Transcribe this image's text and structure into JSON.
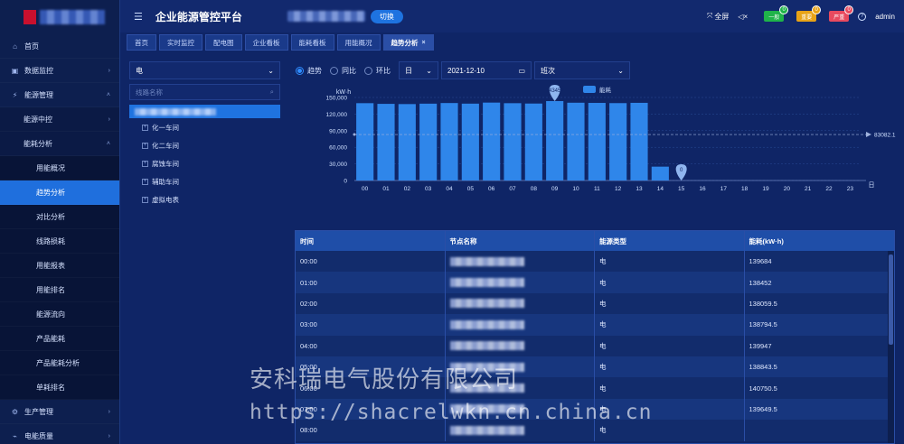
{
  "app": {
    "title": "企业能源管控平台",
    "switch_label": "切换",
    "fullscreen_label": "全屏",
    "user": "admin"
  },
  "alarms": [
    {
      "label": "一般",
      "count": "0",
      "color": "#1fb34a"
    },
    {
      "label": "重要",
      "count": "0",
      "color": "#e8a317"
    },
    {
      "label": "严重",
      "count": "0",
      "color": "#e84a5f"
    }
  ],
  "sidebar": {
    "items": [
      {
        "label": "首页",
        "icon": "home-icon",
        "level": 0,
        "arrow": ""
      },
      {
        "label": "数据监控",
        "icon": "monitor-icon",
        "level": 0,
        "arrow": "›"
      },
      {
        "label": "能源管理",
        "icon": "energy-icon",
        "level": 0,
        "arrow": "˄"
      },
      {
        "label": "能源中控",
        "level": 1,
        "arrow": "›"
      },
      {
        "label": "能耗分析",
        "level": 1,
        "arrow": "˄"
      },
      {
        "label": "用能概况",
        "level": 2,
        "arrow": ""
      },
      {
        "label": "趋势分析",
        "level": 2,
        "arrow": "",
        "active": true
      },
      {
        "label": "对比分析",
        "level": 2,
        "arrow": ""
      },
      {
        "label": "线路损耗",
        "level": 2,
        "arrow": ""
      },
      {
        "label": "用能报表",
        "level": 2,
        "arrow": ""
      },
      {
        "label": "用能排名",
        "level": 2,
        "arrow": ""
      },
      {
        "label": "能源流向",
        "level": 2,
        "arrow": ""
      },
      {
        "label": "产品能耗",
        "level": 2,
        "arrow": ""
      },
      {
        "label": "产品能耗分析",
        "level": 2,
        "arrow": ""
      },
      {
        "label": "单耗排名",
        "level": 2,
        "arrow": ""
      },
      {
        "label": "生产管理",
        "icon": "production-icon",
        "level": 0,
        "arrow": "›"
      },
      {
        "label": "电能质量",
        "icon": "quality-icon",
        "level": 0,
        "arrow": "›"
      }
    ]
  },
  "tabs": [
    {
      "label": "首页"
    },
    {
      "label": "实时监控"
    },
    {
      "label": "配电图"
    },
    {
      "label": "企业看板"
    },
    {
      "label": "能耗看板"
    },
    {
      "label": "用能概况"
    },
    {
      "label": "趋势分析",
      "active": true,
      "closable": "×"
    }
  ],
  "tree": {
    "energy_type": "电",
    "search_placeholder": "线路名称",
    "nodes": [
      "化一车间",
      "化二车间",
      "腐蚀车间",
      "辅助车间",
      "虚拟电表"
    ]
  },
  "filters": {
    "options": [
      {
        "label": "趋势",
        "checked": true
      },
      {
        "label": "同比",
        "checked": false
      },
      {
        "label": "环比",
        "checked": false
      }
    ],
    "period": "日",
    "date": "2021-12-10",
    "shift_label": "班次",
    "shift_value": ""
  },
  "chart_data": {
    "type": "bar",
    "ylabel": "kW·h",
    "legend": "能耗",
    "legend_position": "top",
    "categories": [
      "00",
      "01",
      "02",
      "03",
      "04",
      "05",
      "06",
      "07",
      "08",
      "09",
      "10",
      "11",
      "12",
      "13",
      "14",
      "15",
      "16",
      "17",
      "18",
      "19",
      "20",
      "21",
      "22",
      "23"
    ],
    "values": [
      139684,
      138452,
      138059.5,
      138794.5,
      139947,
      138843.5,
      140750.5,
      139649.5,
      139000,
      143452,
      140500,
      140200,
      139800,
      140300,
      25000,
      0,
      null,
      null,
      null,
      null,
      null,
      null,
      null,
      null
    ],
    "ylim": [
      0,
      150000
    ],
    "yticks": [
      "150,000",
      "120,000",
      "90,000",
      "60,000",
      "30,000",
      "0"
    ],
    "xunit": "日",
    "average_line": {
      "value": 83082,
      "label": "83082.1"
    },
    "max_marker": {
      "category": "09",
      "label": "143452"
    },
    "min_marker": {
      "category": "15",
      "label": "0"
    },
    "bar_color": "#2f86ea"
  },
  "table": {
    "headers": [
      "时间",
      "节点名称",
      "能源类型",
      "能耗(kW·h)"
    ],
    "rows": [
      {
        "time": "00:00",
        "type": "电",
        "value": "139684"
      },
      {
        "time": "01:00",
        "type": "电",
        "value": "138452"
      },
      {
        "time": "02:00",
        "type": "电",
        "value": "138059.5"
      },
      {
        "time": "03:00",
        "type": "电",
        "value": "138794.5"
      },
      {
        "time": "04:00",
        "type": "电",
        "value": "139947"
      },
      {
        "time": "05:00",
        "type": "电",
        "value": "138843.5"
      },
      {
        "time": "06:00",
        "type": "电",
        "value": "140750.5"
      },
      {
        "time": "07:00",
        "type": "电",
        "value": "139649.5"
      },
      {
        "time": "08:00",
        "type": "电",
        "value": ""
      }
    ]
  },
  "watermark": {
    "company": "安科瑞电气股份有限公司",
    "url": "https://shacrelwkn.cn.china.cn"
  }
}
